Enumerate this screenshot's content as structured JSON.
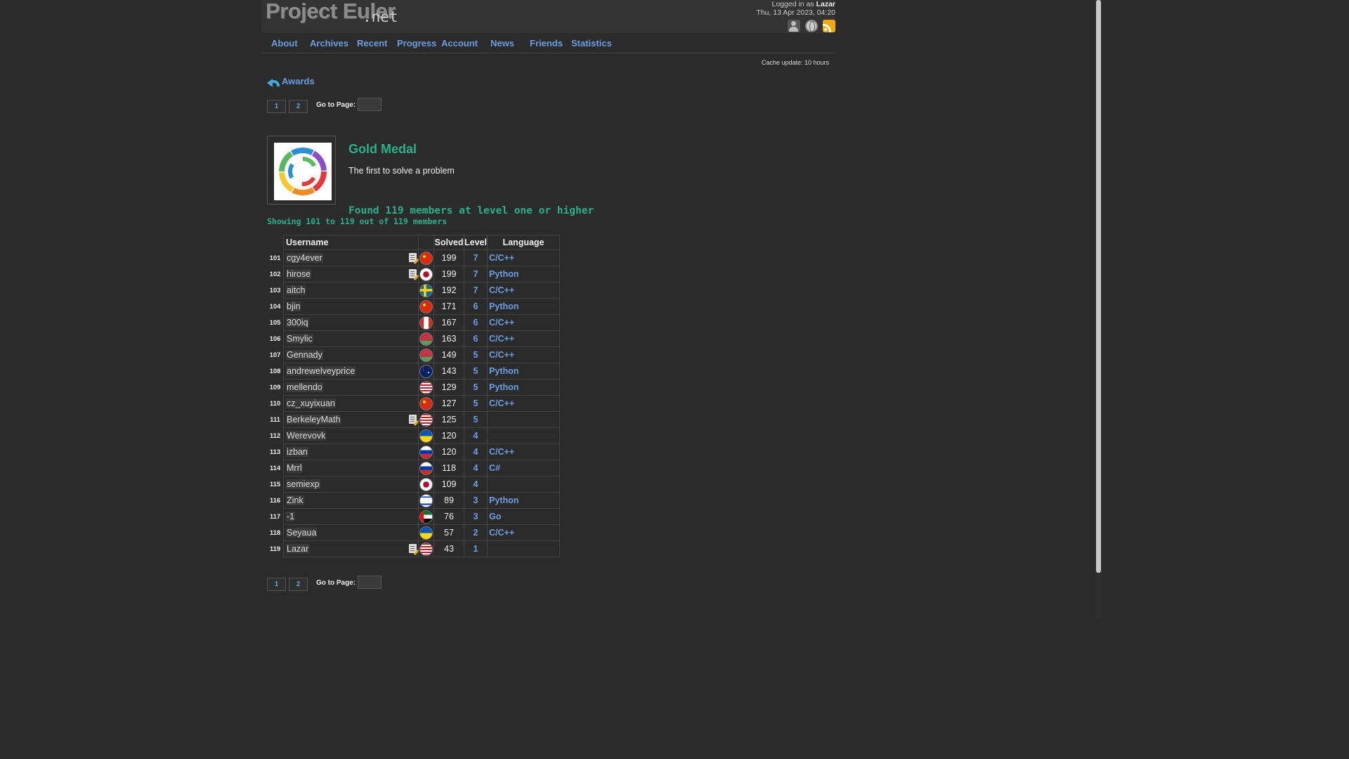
{
  "site": {
    "logo_main": "Project Euler",
    "logo_suffix": ".net"
  },
  "session": {
    "logged_in_prefix": "Logged in as",
    "username": "Lazar",
    "datetime": "Thu, 13 Apr 2023, 04:20"
  },
  "header_icons": [
    "account-icon",
    "globe-icon",
    "rss-icon"
  ],
  "nav": [
    "About",
    "Archives",
    "Recent",
    "Progress",
    "Account",
    "News",
    "Friends",
    "Statistics"
  ],
  "cache": "Cache update: 10 hours",
  "back_link": "Awards",
  "pager": {
    "pages": [
      "1",
      "2"
    ],
    "goto_label": "Go to Page:"
  },
  "award": {
    "title": "Gold Medal",
    "description": "The first to solve a problem",
    "found": "Found 119 members at level one or higher",
    "showing": "Showing 101 to 119 out of 119 members"
  },
  "table": {
    "headers": {
      "username": "Username",
      "solved": "Solved",
      "level": "Level",
      "language": "Language"
    },
    "rows": [
      {
        "rank": "101",
        "user": "cgy4ever",
        "note": true,
        "flag": "cn",
        "solved": "199",
        "level": "7",
        "lang": "C/C++"
      },
      {
        "rank": "102",
        "user": "hirose",
        "note": true,
        "flag": "jp",
        "solved": "199",
        "level": "7",
        "lang": "Python"
      },
      {
        "rank": "103",
        "user": "aitch",
        "note": false,
        "flag": "se",
        "solved": "192",
        "level": "7",
        "lang": "C/C++"
      },
      {
        "rank": "104",
        "user": "bjin",
        "note": false,
        "flag": "cn",
        "solved": "171",
        "level": "6",
        "lang": "Python"
      },
      {
        "rank": "105",
        "user": "300iq",
        "note": false,
        "flag": "ca",
        "solved": "167",
        "level": "6",
        "lang": "C/C++"
      },
      {
        "rank": "106",
        "user": "Smylic",
        "note": false,
        "flag": "by",
        "solved": "163",
        "level": "6",
        "lang": "C/C++"
      },
      {
        "rank": "107",
        "user": "Gennady",
        "note": false,
        "flag": "by",
        "solved": "149",
        "level": "5",
        "lang": "C/C++"
      },
      {
        "rank": "108",
        "user": "andrewelveyprice",
        "note": false,
        "flag": "au",
        "solved": "143",
        "level": "5",
        "lang": "Python"
      },
      {
        "rank": "109",
        "user": "mellendo",
        "note": false,
        "flag": "us",
        "solved": "129",
        "level": "5",
        "lang": "Python"
      },
      {
        "rank": "110",
        "user": "cz_xuyixuan",
        "note": false,
        "flag": "cn",
        "solved": "127",
        "level": "5",
        "lang": "C/C++"
      },
      {
        "rank": "111",
        "user": "BerkeleyMath",
        "note": true,
        "flag": "us",
        "solved": "125",
        "level": "5",
        "lang": ""
      },
      {
        "rank": "112",
        "user": "Werevovk",
        "note": false,
        "flag": "ua",
        "solved": "120",
        "level": "4",
        "lang": ""
      },
      {
        "rank": "113",
        "user": "izban",
        "note": false,
        "flag": "ru",
        "solved": "120",
        "level": "4",
        "lang": "C/C++"
      },
      {
        "rank": "114",
        "user": "Mrrl",
        "note": false,
        "flag": "ru",
        "solved": "118",
        "level": "4",
        "lang": "C#"
      },
      {
        "rank": "115",
        "user": "semiexp",
        "note": false,
        "flag": "jp",
        "solved": "109",
        "level": "4",
        "lang": ""
      },
      {
        "rank": "116",
        "user": "Zink",
        "note": false,
        "flag": "il",
        "solved": "89",
        "level": "3",
        "lang": "Python"
      },
      {
        "rank": "117",
        "user": "-1",
        "note": false,
        "flag": "ae",
        "solved": "76",
        "level": "3",
        "lang": "Go"
      },
      {
        "rank": "118",
        "user": "Seyaua",
        "note": false,
        "flag": "ua",
        "solved": "57",
        "level": "2",
        "lang": "C/C++"
      },
      {
        "rank": "119",
        "user": "Lazar",
        "note": true,
        "flag": "us",
        "solved": "43",
        "level": "1",
        "lang": ""
      }
    ]
  }
}
